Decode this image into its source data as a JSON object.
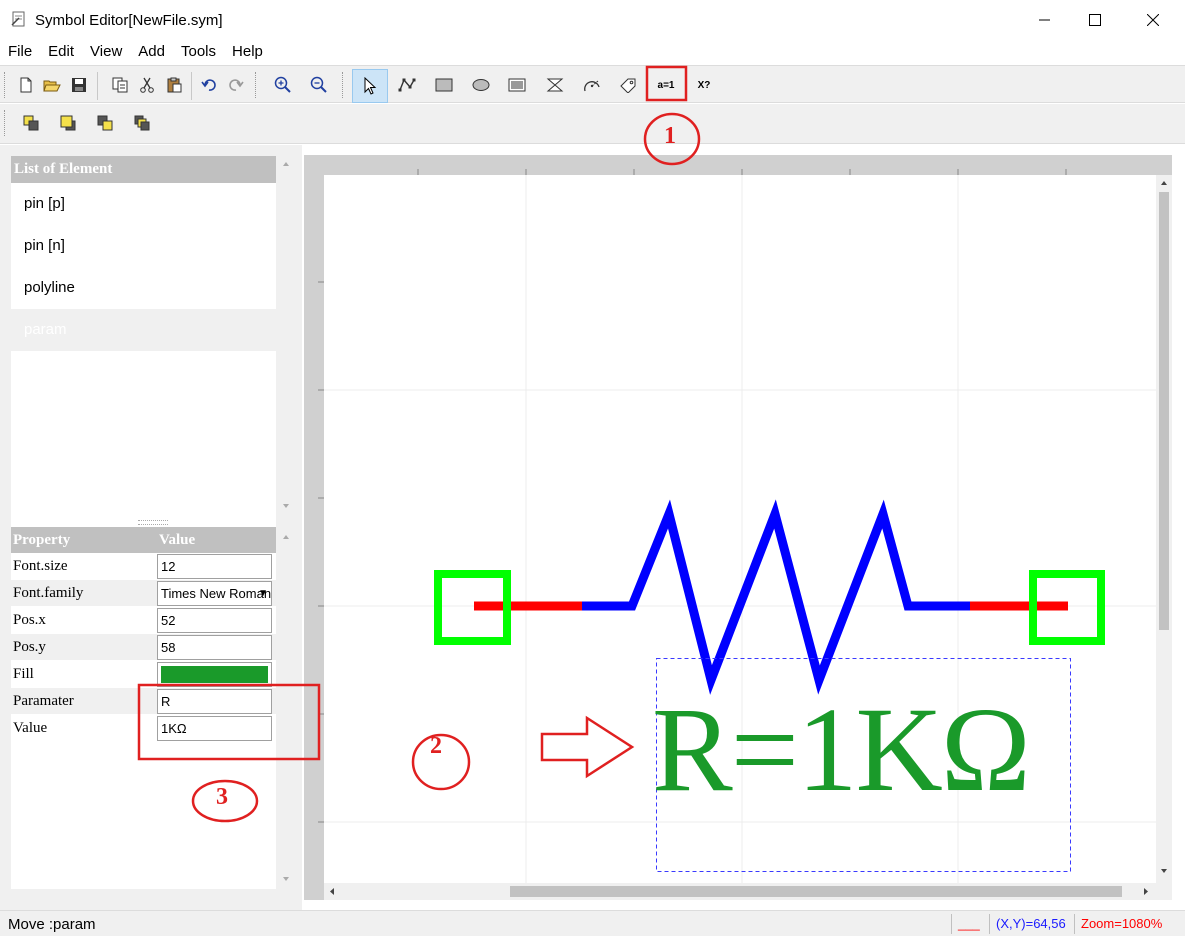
{
  "window": {
    "title": "Symbol Editor[NewFile.sym]",
    "min_glyph": "—",
    "max_glyph": "☐",
    "close_glyph": "✕"
  },
  "menu": [
    "File",
    "Edit",
    "View",
    "Add",
    "Tools",
    "Help"
  ],
  "toolbar": {
    "param_button_label": "a=1",
    "subscript_button_label": "X?"
  },
  "element_list": {
    "header": "List of Element",
    "items": [
      "pin [p]",
      "pin [n]",
      "polyline",
      "param"
    ],
    "selected_index": 3
  },
  "properties": {
    "header_property": "Property",
    "header_value": "Value",
    "rows": [
      {
        "name": "Font.size",
        "value": "12"
      },
      {
        "name": "Font.family",
        "value": "Times New Roman"
      },
      {
        "name": "Pos.x",
        "value": "52"
      },
      {
        "name": "Pos.y",
        "value": "58"
      },
      {
        "name": "Fill",
        "value": ""
      },
      {
        "name": "Paramater",
        "value": "R"
      },
      {
        "name": "Value",
        "value": "1KΩ"
      }
    ],
    "fill_color": "#1a9a2a"
  },
  "canvas": {
    "param_text": "R=1KΩ",
    "text_color": "#1a9a2a",
    "pin_color": "#00ff00",
    "lead_color": "#ff0000",
    "body_color": "#0000ff",
    "selection_color": "#3a3aff"
  },
  "annotations": {
    "one": "1",
    "two": "2",
    "three": "3",
    "color": "#e02020"
  },
  "status": {
    "message": "Move :param",
    "line_sample": "___",
    "coords": "(X,Y)=64,56",
    "zoom": "Zoom=1080%"
  }
}
